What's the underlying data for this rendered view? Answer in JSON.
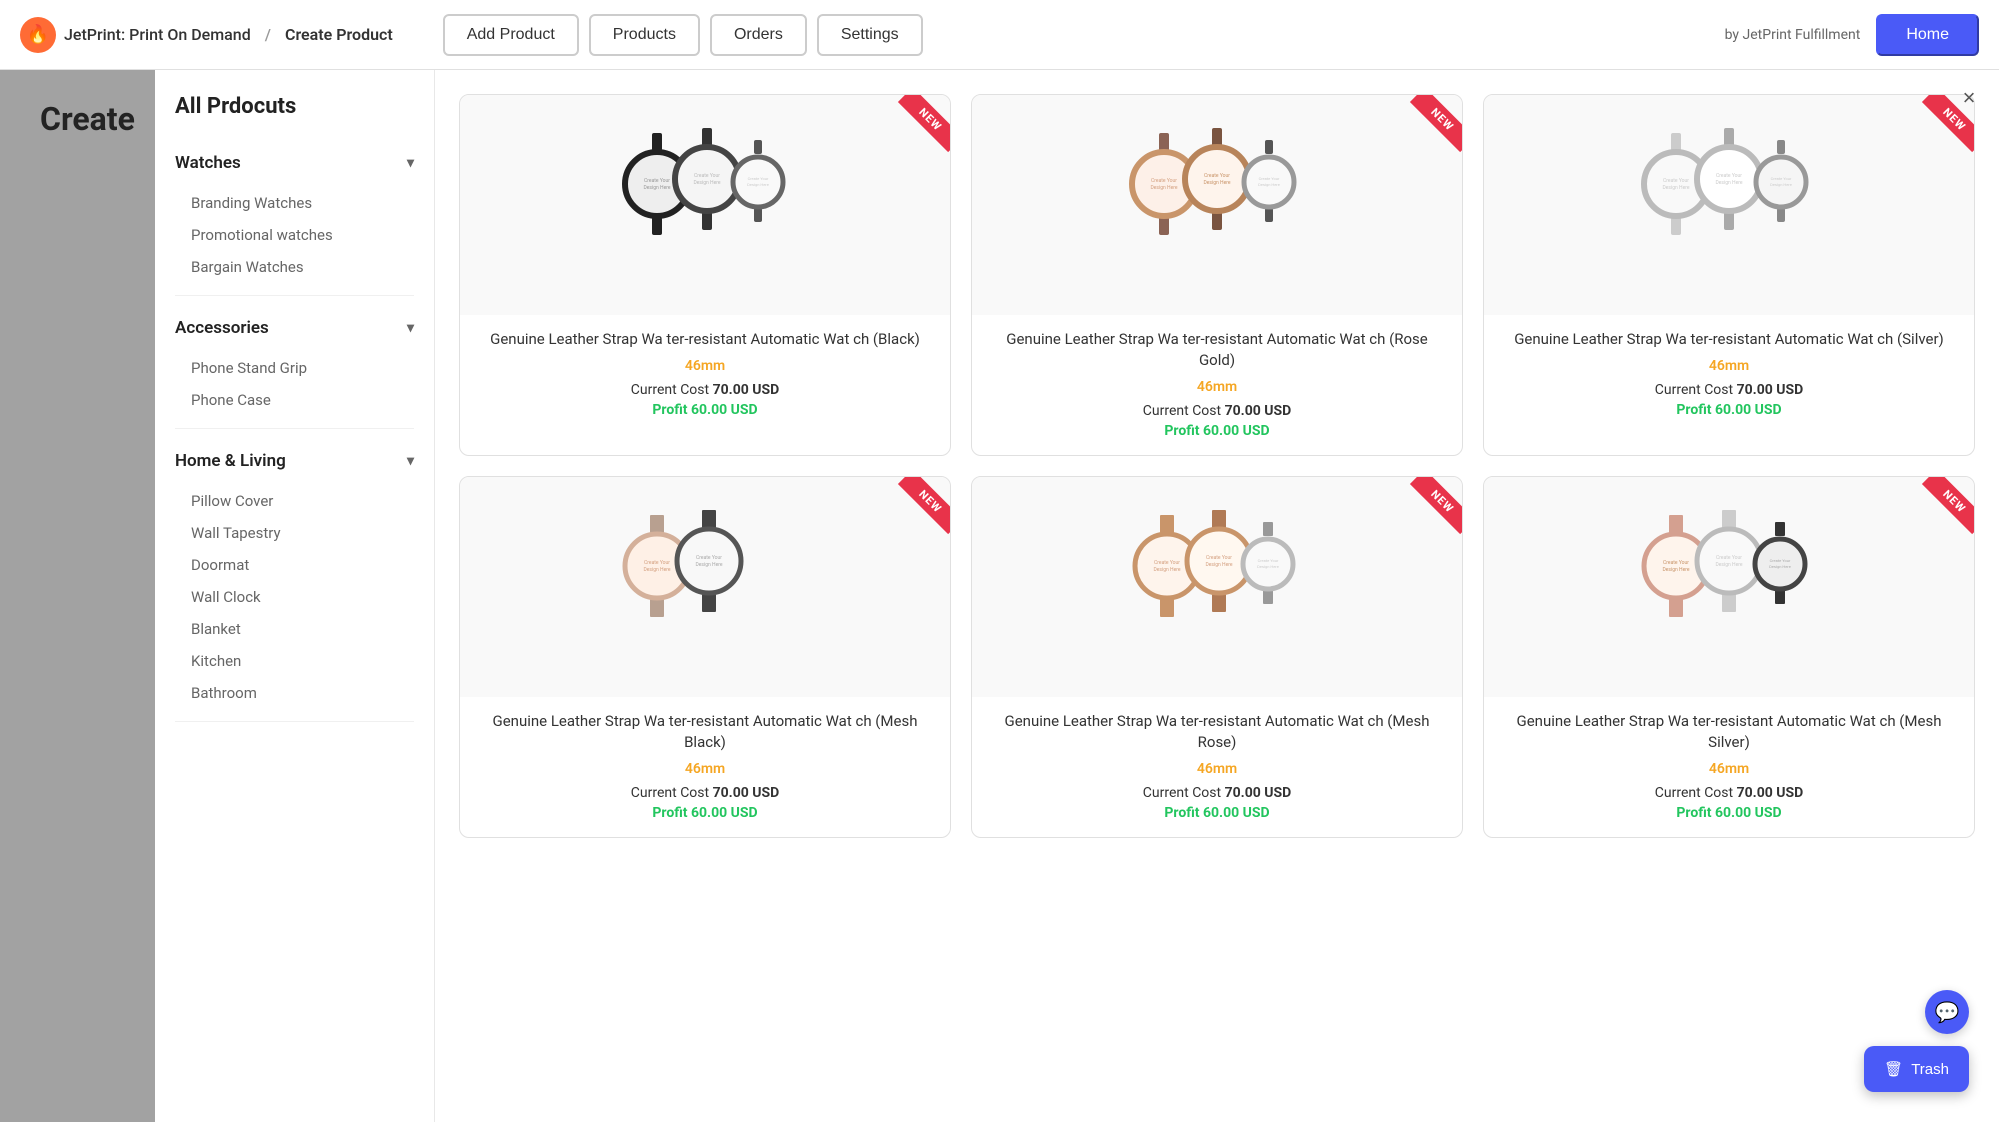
{
  "app": {
    "logo_emoji": "🔥",
    "logo_text": "JetPrint: Print On Demand",
    "breadcrumb_separator": "/",
    "breadcrumb_page": "Create Product",
    "by_text": "by JetPrint Fulfillment"
  },
  "header": {
    "nav": [
      {
        "label": "Add Product",
        "id": "add-product"
      },
      {
        "label": "Products",
        "id": "products"
      },
      {
        "label": "Orders",
        "id": "orders"
      },
      {
        "label": "Settings",
        "id": "settings"
      }
    ],
    "home_label": "Home"
  },
  "bg": {
    "title": "Create"
  },
  "modal": {
    "title": "All Prdocuts",
    "close_label": "×",
    "categories": [
      {
        "id": "watches",
        "label": "Watches",
        "expanded": true,
        "items": [
          "Branding Watches",
          "Promotional watches",
          "Bargain Watches"
        ]
      },
      {
        "id": "accessories",
        "label": "Accessories",
        "expanded": true,
        "items": [
          "Phone Stand Grip",
          "Phone Case"
        ]
      },
      {
        "id": "home-living",
        "label": "Home & Living",
        "expanded": true,
        "items": [
          "Pillow Cover",
          "Wall Tapestry",
          "Doormat",
          "Wall Clock",
          "Blanket",
          "Kitchen",
          "Bathroom"
        ]
      }
    ]
  },
  "products": [
    {
      "id": 1,
      "name": "Genuine Leather Strap Water-resistant Automatic Watch (Black)",
      "size": "46mm",
      "current_cost": "70.00 USD",
      "profit": "60.00 USD",
      "is_new": true,
      "color_scheme": "dark"
    },
    {
      "id": 2,
      "name": "Genuine Leather Strap Water-resistant Automatic Watch (Rose Gold)",
      "size": "46mm",
      "current_cost": "70.00 USD",
      "profit": "60.00 USD",
      "is_new": true,
      "color_scheme": "rose-gold"
    },
    {
      "id": 3,
      "name": "Genuine Leather Strap Water-resistant Automatic Watch (Silver)",
      "size": "46mm",
      "current_cost": "70.00 USD",
      "profit": "60.00 USD",
      "is_new": true,
      "color_scheme": "silver"
    },
    {
      "id": 4,
      "name": "Genuine Leather Strap Water-resistant Automatic Watch (Mesh Black)",
      "size": "46mm",
      "current_cost": "70.00 USD",
      "profit": "60.00 USD",
      "is_new": true,
      "color_scheme": "mesh-dark"
    },
    {
      "id": 5,
      "name": "Genuine Leather Strap Water-resistant Automatic Watch (Mesh Rose)",
      "size": "46mm",
      "current_cost": "70.00 USD",
      "profit": "60.00 USD",
      "is_new": true,
      "color_scheme": "mesh-rose"
    },
    {
      "id": 6,
      "name": "Genuine Leather Strap Water-resistant Automatic Watch (Mesh Silver)",
      "size": "46mm",
      "current_cost": "70.00 USD",
      "profit": "60.00 USD",
      "is_new": true,
      "color_scheme": "mesh-silver"
    }
  ],
  "labels": {
    "current_cost_prefix": "Current Cost",
    "profit_prefix": "Profit"
  },
  "trash": {
    "label": "Trash",
    "icon": "🗑"
  }
}
